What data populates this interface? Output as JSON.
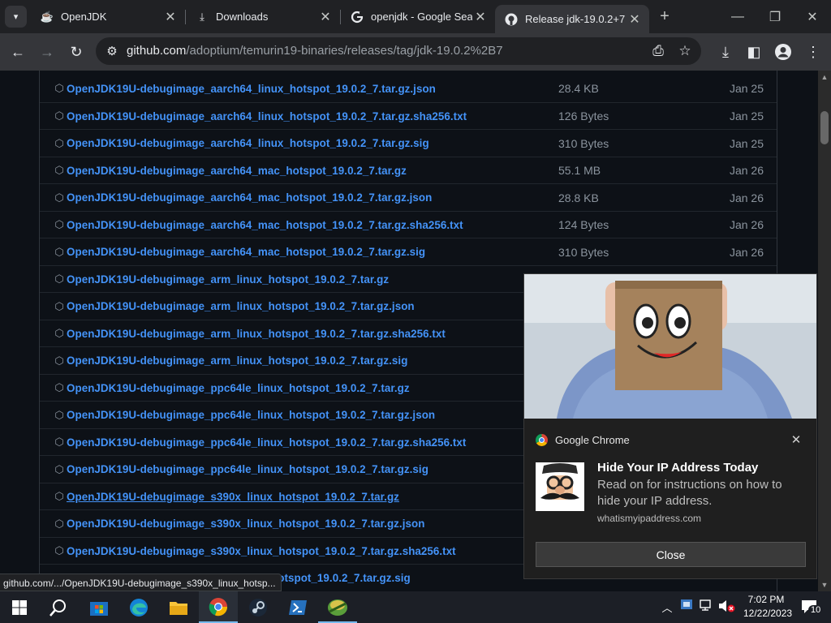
{
  "tabs": [
    {
      "title": "OpenJDK",
      "icon": "openjdk-icon",
      "active": false
    },
    {
      "title": "Downloads",
      "icon": "download-icon",
      "active": false
    },
    {
      "title": "openjdk - Google Sea",
      "icon": "google-icon",
      "active": false
    },
    {
      "title": "Release jdk-19.0.2+7 ·",
      "icon": "github-icon",
      "active": true
    }
  ],
  "toolbar": {
    "url_host": "github.com",
    "url_path": "/adoptium/temurin19-binaries/releases/tag/jdk-19.0.2%2B7"
  },
  "assets": [
    {
      "name": "OpenJDK19U-debugimage_aarch64_linux_hotspot_19.0.2_7.tar.gz.json",
      "size": "28.4 KB",
      "date": "Jan 25"
    },
    {
      "name": "OpenJDK19U-debugimage_aarch64_linux_hotspot_19.0.2_7.tar.gz.sha256.txt",
      "size": "126 Bytes",
      "date": "Jan 25"
    },
    {
      "name": "OpenJDK19U-debugimage_aarch64_linux_hotspot_19.0.2_7.tar.gz.sig",
      "size": "310 Bytes",
      "date": "Jan 25"
    },
    {
      "name": "OpenJDK19U-debugimage_aarch64_mac_hotspot_19.0.2_7.tar.gz",
      "size": "55.1 MB",
      "date": "Jan 26"
    },
    {
      "name": "OpenJDK19U-debugimage_aarch64_mac_hotspot_19.0.2_7.tar.gz.json",
      "size": "28.8 KB",
      "date": "Jan 26"
    },
    {
      "name": "OpenJDK19U-debugimage_aarch64_mac_hotspot_19.0.2_7.tar.gz.sha256.txt",
      "size": "124 Bytes",
      "date": "Jan 26"
    },
    {
      "name": "OpenJDK19U-debugimage_aarch64_mac_hotspot_19.0.2_7.tar.gz.sig",
      "size": "310 Bytes",
      "date": "Jan 26"
    },
    {
      "name": "OpenJDK19U-debugimage_arm_linux_hotspot_19.0.2_7.tar.gz",
      "size": "",
      "date": ""
    },
    {
      "name": "OpenJDK19U-debugimage_arm_linux_hotspot_19.0.2_7.tar.gz.json",
      "size": "",
      "date": ""
    },
    {
      "name": "OpenJDK19U-debugimage_arm_linux_hotspot_19.0.2_7.tar.gz.sha256.txt",
      "size": "",
      "date": ""
    },
    {
      "name": "OpenJDK19U-debugimage_arm_linux_hotspot_19.0.2_7.tar.gz.sig",
      "size": "",
      "date": ""
    },
    {
      "name": "OpenJDK19U-debugimage_ppc64le_linux_hotspot_19.0.2_7.tar.gz",
      "size": "",
      "date": ""
    },
    {
      "name": "OpenJDK19U-debugimage_ppc64le_linux_hotspot_19.0.2_7.tar.gz.json",
      "size": "",
      "date": ""
    },
    {
      "name": "OpenJDK19U-debugimage_ppc64le_linux_hotspot_19.0.2_7.tar.gz.sha256.txt",
      "size": "",
      "date": ""
    },
    {
      "name": "OpenJDK19U-debugimage_ppc64le_linux_hotspot_19.0.2_7.tar.gz.sig",
      "size": "",
      "date": ""
    },
    {
      "name": "OpenJDK19U-debugimage_s390x_linux_hotspot_19.0.2_7.tar.gz",
      "size": "",
      "date": "",
      "hover": true
    },
    {
      "name": "OpenJDK19U-debugimage_s390x_linux_hotspot_19.0.2_7.tar.gz.json",
      "size": "",
      "date": ""
    },
    {
      "name": "OpenJDK19U-debugimage_s390x_linux_hotspot_19.0.2_7.tar.gz.sha256.txt",
      "size": "",
      "date": ""
    },
    {
      "name": "hotspot_19.0.2_7.tar.gz.sig",
      "size": "",
      "date": ""
    }
  ],
  "status_bar": "github.com/.../OpenJDK19U-debugimage_s390x_linux_hotsp...",
  "notification": {
    "app": "Google Chrome",
    "title": "Hide Your IP Address Today",
    "body": "Read on for instructions on how to hide your IP address.",
    "site": "whatismyipaddress.com",
    "close_label": "Close"
  },
  "taskbar": {
    "apps": [
      "windows-start",
      "search",
      "microsoft-store",
      "edge",
      "file-explorer",
      "chrome",
      "steam",
      "powershell",
      "app"
    ],
    "time": "7:02 PM",
    "date": "12/22/2023",
    "notifications": "10"
  },
  "colors": {
    "link": "#4493f8",
    "muted": "#8b949e",
    "page_bg": "#0d1117"
  }
}
